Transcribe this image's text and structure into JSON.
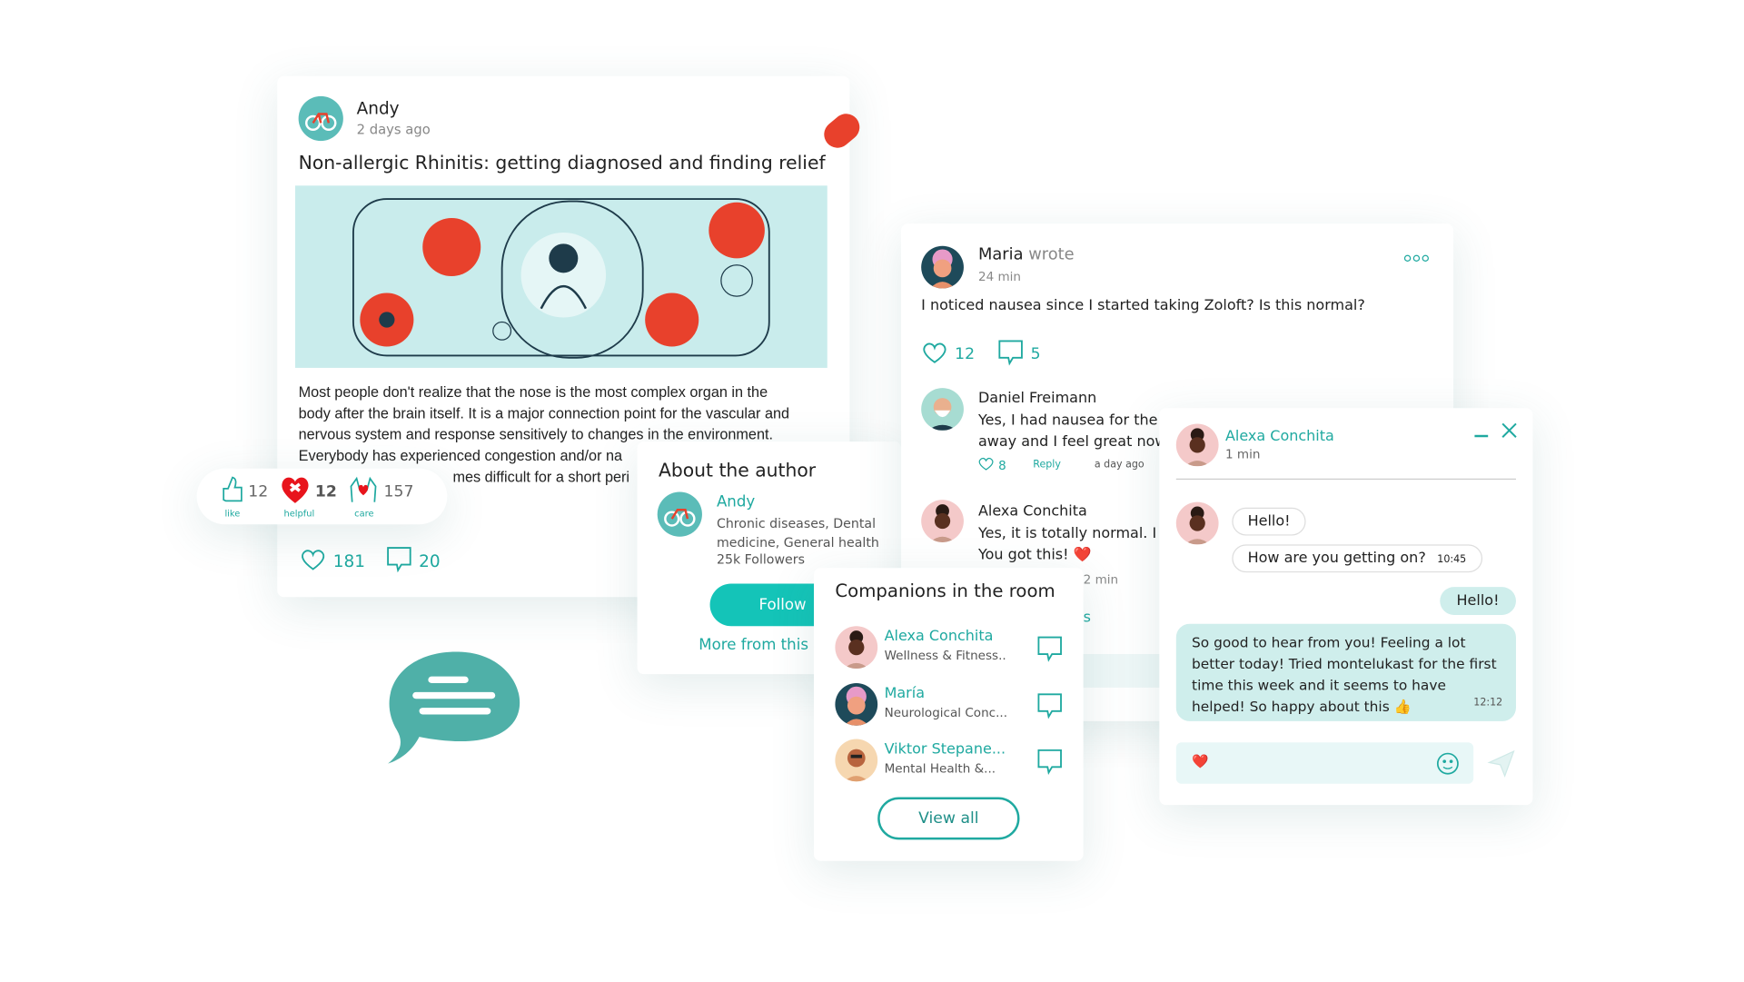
{
  "post": {
    "author": "Andy",
    "time": "2 days ago",
    "title": "Non-allergic Rhinitis: getting diagnosed and finding relief",
    "body_lines": [
      "Most people don't realize that the nose is the most complex organ in the",
      "body after the brain itself. It is a major connection point for the vascular and",
      "nervous system and response sensitively to changes in the environment.",
      "Everybody has experienced congestion and/or na",
      "mes difficult for a short peri"
    ],
    "likes": "181",
    "comments": "20"
  },
  "reactions": [
    {
      "icon": "thumbs-up-icon",
      "count": "12",
      "label": "like"
    },
    {
      "icon": "heart-bandage-icon",
      "count": "12",
      "label": "helpful"
    },
    {
      "icon": "care-hands-icon",
      "count": "157",
      "label": "care"
    }
  ],
  "about": {
    "title": "About the author",
    "name": "Andy",
    "specialties": "Chronic diseases, Dental medicine, General health",
    "followers": "25k Followers",
    "follow_label": "Follow",
    "more_label": "More from this a"
  },
  "thread": {
    "author": "Maria",
    "wrote": "wrote",
    "time": "24 min",
    "question": "I noticed nausea since I started taking Zoloft? Is this normal?",
    "likes": "12",
    "comments": "5",
    "replies": [
      {
        "name": "Daniel Freimann",
        "lines": [
          "Yes, I had nausea for the fir",
          "away and I feel great now."
        ],
        "likes": "8",
        "reply_label": "Reply",
        "time": "a day ago"
      },
      {
        "name": "Alexa Conchita",
        "lines": [
          "Yes, it is totally normal. I fo",
          "You got this! ❤️"
        ],
        "time": "2 min",
        "extra": "s"
      }
    ]
  },
  "companions": {
    "title": "Companions in the room",
    "items": [
      {
        "name": "Alexa Conchita",
        "topic": "Wellness & Fitness.."
      },
      {
        "name": "María",
        "topic": "Neurological Conc..."
      },
      {
        "name": "Viktor Stepane...",
        "topic": "Mental Health &..."
      }
    ],
    "view_all_label": "View all"
  },
  "chat": {
    "name": "Alexa Conchita",
    "status": "1 min",
    "messages": [
      {
        "from": "them",
        "text": "Hello!"
      },
      {
        "from": "them",
        "text": "How are you getting on?",
        "time": "10:45"
      },
      {
        "from": "me",
        "text": "Hello!"
      },
      {
        "from": "me",
        "text": "So good to hear from you! Feeling a lot better today! Tried montelukast for the first time this week and it seems to have helped! So happy about this 👍",
        "time": "12:12"
      }
    ],
    "input_value": "❤️"
  },
  "colors": {
    "accent": "#1fa9a0",
    "button": "#14c4b8",
    "bubble": "#cfeeec",
    "red": "#e8412c",
    "illustration_bg": "#c9ecec"
  }
}
